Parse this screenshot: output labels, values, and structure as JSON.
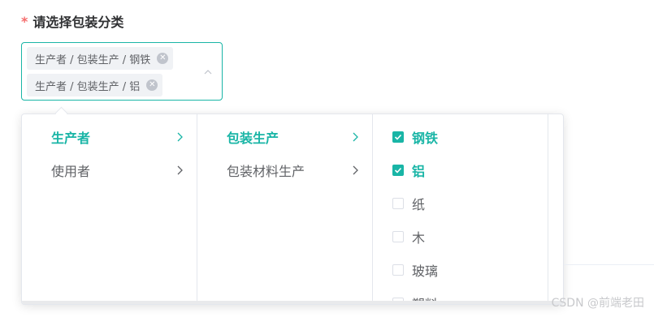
{
  "form": {
    "required_mark": "*",
    "label": "请选择包装分类"
  },
  "cascader": {
    "tags": [
      {
        "label": "生产者 / 包装生产 / 钢铁"
      },
      {
        "label": "生产者 / 包装生产 / 铝"
      }
    ],
    "arrow_icon": "chevron-up-icon"
  },
  "dropdown": {
    "column1": [
      {
        "label": "生产者",
        "active": true
      },
      {
        "label": "使用者",
        "active": false
      }
    ],
    "column2": [
      {
        "label": "包装生产",
        "active": true
      },
      {
        "label": "包装材料生产",
        "active": false
      }
    ],
    "column3": [
      {
        "label": "钢铁",
        "checked": true
      },
      {
        "label": "铝",
        "checked": true
      },
      {
        "label": "纸",
        "checked": false
      },
      {
        "label": "木",
        "checked": false
      },
      {
        "label": "玻璃",
        "checked": false
      },
      {
        "label": "塑料",
        "checked": false
      }
    ]
  },
  "watermark": "CSDN @前端老田",
  "colors": {
    "accent": "#19b5a6",
    "required": "#f56c6c",
    "tag_bg": "#f0f2f5",
    "border": "#e4e7ed"
  }
}
